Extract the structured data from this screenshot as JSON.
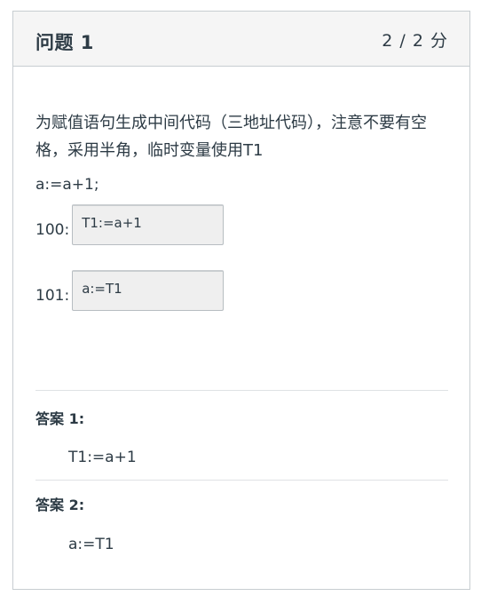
{
  "question": {
    "title": "问题 1",
    "points": "2 / 2 分",
    "prompt": "为赋值语句生成中间代码（三地址代码），注意不要有空格，采用半角，临时变量使用T1",
    "statement": "a:=a+1;"
  },
  "blanks": [
    {
      "label": "100:",
      "value": "T1:=a+1"
    },
    {
      "label": "101:",
      "value": "a:=T1"
    }
  ],
  "answers": [
    {
      "label": "答案 1:",
      "value": "T1:=a+1"
    },
    {
      "label": "答案 2:",
      "value": "a:=T1"
    }
  ]
}
